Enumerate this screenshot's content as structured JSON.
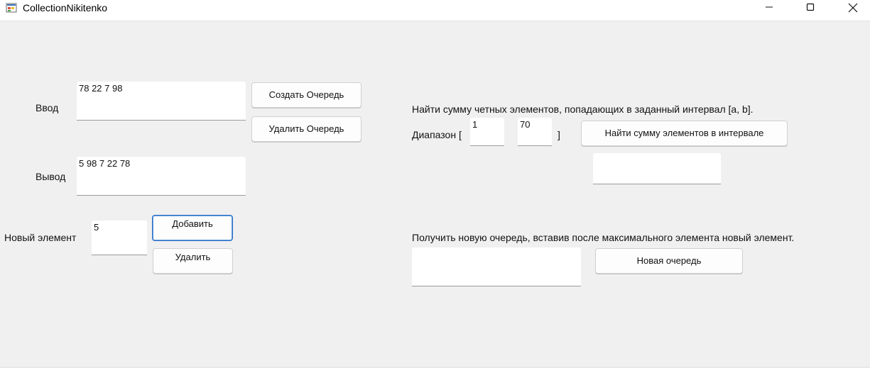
{
  "window": {
    "title": "CollectionNikitenko",
    "icon": "winforms-app-icon",
    "controls": [
      "minimize-icon",
      "maximize-icon",
      "close-icon"
    ]
  },
  "left": {
    "input_label": "Ввод",
    "input_value": "78 22 7 98",
    "create_button": "Создать Очередь",
    "delete_queue_button": "Удалить Очередь",
    "output_label": "Вывод",
    "output_value": "5 98 7 22 78",
    "new_element_label": "Новый элемент",
    "new_element_value": "5",
    "add_button": "Добавить",
    "remove_button": "Удалить"
  },
  "task1": {
    "description": "Найти сумму четных элементов, попадающих в заданный интервал [a, b].",
    "range_label": "Диапазон [",
    "range_a": "1",
    "range_close": "]",
    "range_b": "70",
    "find_button": "Найти сумму элементов в интервале",
    "result": ""
  },
  "task2": {
    "description": "Получить новую очередь, вставив после максимального элемента новый элемент.",
    "result": "",
    "new_queue_button": "Новая очередь"
  },
  "colors": {
    "background": "#f0f0f0",
    "focus_border": "#2b6fc5"
  }
}
